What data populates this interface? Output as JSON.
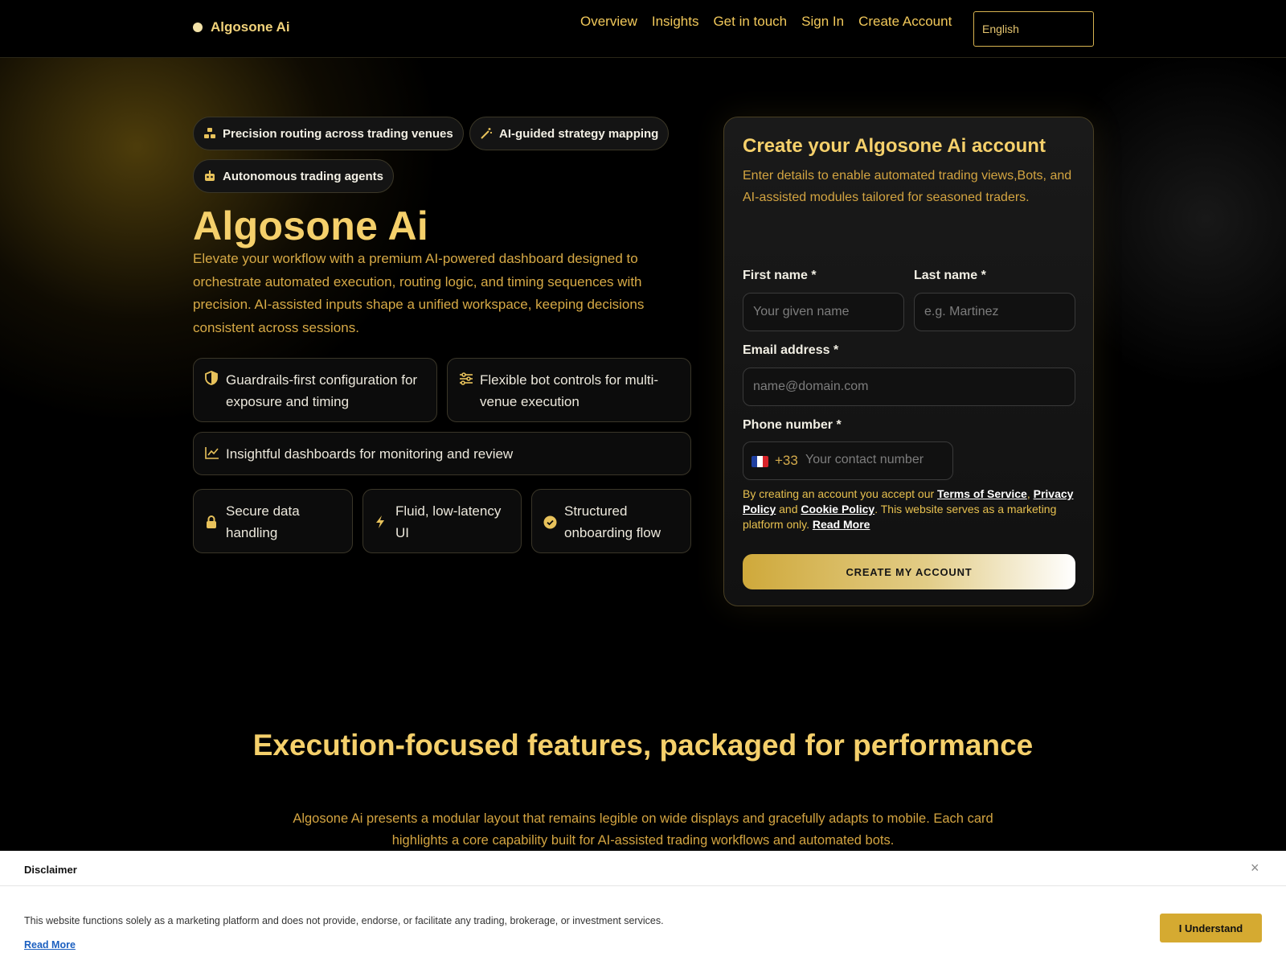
{
  "brand": {
    "name": "Algosone Ai"
  },
  "nav": {
    "links": [
      "Overview",
      "Insights",
      "Get in touch",
      "Sign In",
      "Create Account"
    ],
    "language": "English"
  },
  "hero": {
    "pills": [
      {
        "label": "Precision routing across trading venues",
        "icon": "network-icon"
      },
      {
        "label": "AI-guided strategy mapping",
        "icon": "magic-wand-icon"
      },
      {
        "label": "Autonomous trading agents",
        "icon": "robot-icon"
      }
    ],
    "title": "Algosone Ai",
    "description": "Elevate your workflow with a premium AI-powered dashboard designed to orchestrate automated execution, routing logic, and timing sequences with precision. AI-assisted inputs shape a unified workspace, keeping decisions consistent across sessions.",
    "cards": [
      {
        "label": "Guardrails-first configuration for exposure and timing",
        "icon": "shield-icon"
      },
      {
        "label": "Flexible bot controls for multi-venue execution",
        "icon": "sliders-icon"
      },
      {
        "label": "Insightful dashboards for monitoring and review",
        "icon": "chart-line-icon"
      },
      {
        "label": "Secure data handling",
        "icon": "lock-icon"
      },
      {
        "label": "Fluid, low-latency UI",
        "icon": "bolt-icon"
      },
      {
        "label": "Structured onboarding flow",
        "icon": "check-circle-icon"
      }
    ]
  },
  "signup": {
    "title": "Create your Algosone Ai account",
    "subtitle": "Enter details to enable automated trading views,Bots, and AI-assisted modules tailored for seasoned traders.",
    "first_name_label": "First name *",
    "first_name_placeholder": "Your given name",
    "last_name_label": "Last name *",
    "last_name_placeholder": "e.g. Martinez",
    "email_label": "Email address *",
    "email_placeholder": "name@domain.com",
    "phone_label": "Phone number *",
    "phone_code": "+33",
    "phone_placeholder": "Your contact number",
    "flag_icon": "france-flag-icon",
    "terms_prefix": "By creating an account you accept our ",
    "terms_link": "Terms of Service",
    "terms_comma": ",",
    "privacy_link": "Privacy Policy",
    "terms_and": " and ",
    "cookie_link": "Cookie Policy",
    "terms_suffix": ". This website serves as a marketing platform only. ",
    "read_more": "Read More",
    "cta": "CREATE MY ACCOUNT"
  },
  "features": {
    "title": "Execution-focused features, packaged for performance",
    "description": "Algosone Ai presents a modular layout that remains legible on wide displays and gracefully adapts to mobile. Each card highlights a core capability built for AI-assisted trading workflows and automated bots."
  },
  "disclaimer": {
    "title": "Disclaimer",
    "close": "×",
    "body": "This website functions solely as a marketing platform and does not provide, endorse, or facilitate any trading, brokerage, or investment services.",
    "read_more": "Read More",
    "button": "I Understand"
  },
  "colors": {
    "accent": "#f5d06b",
    "gold": "#d5aa31",
    "background": "#000000"
  }
}
